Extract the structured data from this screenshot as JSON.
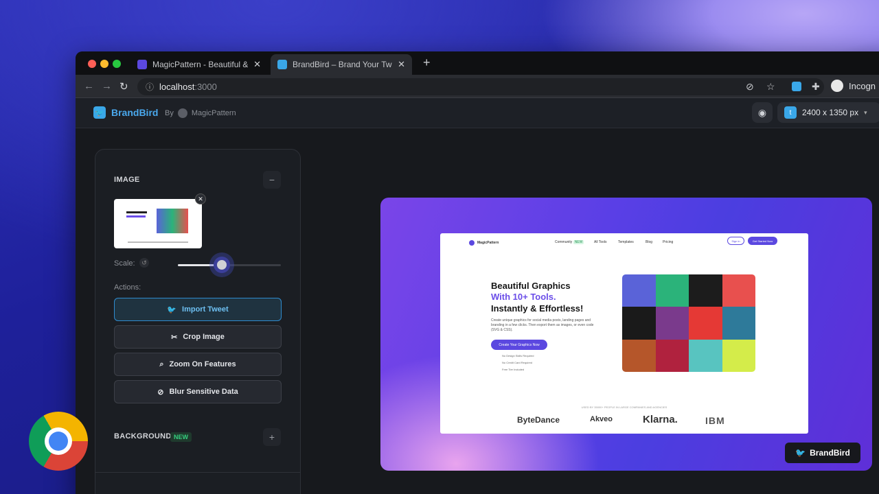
{
  "browser": {
    "tabs": [
      {
        "title": "MagicPattern - Beautiful & coo",
        "active": false
      },
      {
        "title": "BrandBird – Brand Your Twitter",
        "active": true
      }
    ],
    "new_tab": "+",
    "close_glyph": "✕",
    "url_host": "localhost",
    "url_port": ":3000",
    "profile_label": "Incogn"
  },
  "app": {
    "brand": "BrandBird",
    "by": "By",
    "partner": "MagicPattern",
    "canvas_size": "2400 x 1350 px"
  },
  "panel": {
    "image_section": "IMAGE",
    "scale_label": "Scale:",
    "scale_value": 0.42,
    "actions_label": "Actions:",
    "actions": [
      "Import Tweet",
      "Crop Image",
      "Zoom On Features",
      "Blur Sensitive Data"
    ],
    "background_section": "BACKGROUND",
    "new_badge": "NEW"
  },
  "preview": {
    "site_brand": "MagicPattern",
    "nav": [
      "Community",
      "All Tools",
      "Templates",
      "Blog",
      "Pricing"
    ],
    "community_badge": "NEW",
    "signin": "Sign in",
    "get_started": "Get Started Now",
    "hero_line1": "Beautiful Graphics",
    "hero_line2": "With 10+ Tools.",
    "hero_line3": "Instantly & Effortless!",
    "hero_paragraph": "Create unique graphics for social media posts, landing pages and branding in a few clicks. Then export them as images, or even code (SVG & CSS).",
    "hero_button": "Create Your Graphics Now",
    "checks": [
      "No Design Skills Required",
      "No Credit Card Required",
      "Free Tier Included"
    ],
    "used_by": "USED BY 35000+ PEOPLE IN LARGE COMPANIES AND AGENCIES",
    "logos": [
      "ByteDance",
      "Akveo",
      "Klarna.",
      "IBM"
    ],
    "grid_colors": [
      "#5a63d8",
      "#2bb37a",
      "#1c1c1c",
      "#e8504e",
      "#1a1a1a",
      "#7a3a8c",
      "#e53935",
      "#2e7a9a",
      "#b5562a",
      "#b0223e",
      "#58c4c0",
      "#d4ec4a"
    ],
    "badge": "BrandBird"
  },
  "colors": {
    "accent": "#4aa9ee",
    "new": "#35d07f",
    "purple": "#6a4de8"
  }
}
